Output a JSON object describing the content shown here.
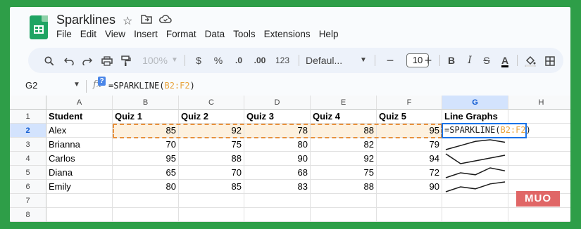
{
  "app": {
    "title": "Sparklines",
    "menu": [
      "File",
      "Edit",
      "View",
      "Insert",
      "Format",
      "Data",
      "Tools",
      "Extensions",
      "Help"
    ]
  },
  "toolbar": {
    "zoom": "100%",
    "currency": "$",
    "percent": "%",
    "dec_less": ".0",
    "dec_more": ".00",
    "number_format": "123",
    "font": "Defaul...",
    "font_size": "10",
    "bold": "B"
  },
  "formula_bar": {
    "name_box": "G2",
    "fx": "fx",
    "badge": "?",
    "formula_prefix": "=SPARKLINE(",
    "formula_ref": "B2:F2",
    "formula_suffix": ")"
  },
  "sheet": {
    "columns": [
      "A",
      "B",
      "C",
      "D",
      "E",
      "F",
      "G",
      "H"
    ],
    "selected_column": "G",
    "rows": [
      "1",
      "2",
      "3",
      "4",
      "5",
      "6",
      "7",
      "8"
    ],
    "selected_row": "2",
    "headers": [
      "Student",
      "Quiz 1",
      "Quiz 2",
      "Quiz 3",
      "Quiz 4",
      "Quiz 5",
      "Line Graphs"
    ],
    "data": [
      {
        "name": "Alex",
        "scores": [
          85,
          92,
          78,
          88,
          95
        ]
      },
      {
        "name": "Brianna",
        "scores": [
          70,
          75,
          80,
          82,
          79
        ]
      },
      {
        "name": "Carlos",
        "scores": [
          95,
          88,
          90,
          92,
          94
        ]
      },
      {
        "name": "Diana",
        "scores": [
          65,
          70,
          68,
          75,
          72
        ]
      },
      {
        "name": "Emily",
        "scores": [
          80,
          85,
          83,
          88,
          90
        ]
      }
    ],
    "active_cell_formula_prefix": "=SPARKLINE(",
    "active_cell_formula_ref": "B2:F2",
    "active_cell_formula_suffix": ")",
    "sparkline_color": "#1a1a1a",
    "highlight_color": "#fdf1df",
    "range_border_color": "#e8913c"
  },
  "watermark": "MUO"
}
